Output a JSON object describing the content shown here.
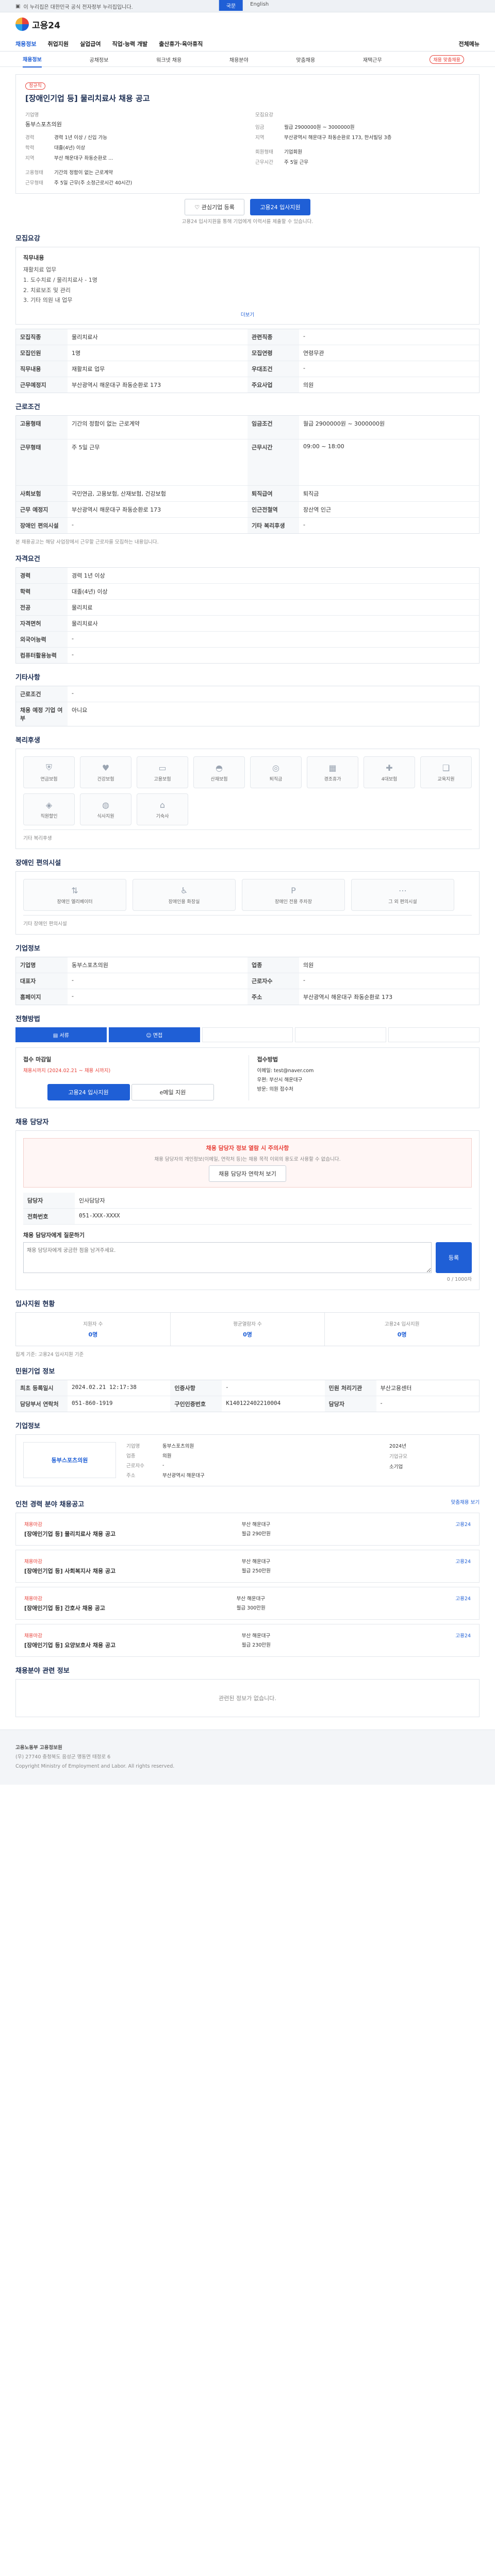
{
  "topbar": {
    "notice": "이 누리집은 대한민국 공식 전자정부 누리집입니다.",
    "lang_ko": "국문",
    "lang_en": "English"
  },
  "header": {
    "logo": "고용24",
    "menu": [
      "채용정보",
      "취업지원",
      "실업급여",
      "직업·능력 개발",
      "출산휴가·육아휴직"
    ],
    "right_menu": "전체메뉴"
  },
  "subtabs": {
    "items": [
      "채용정보",
      "공채정보",
      "워크넷 채용",
      "채용분야",
      "맞춤채용",
      "재택근무"
    ],
    "badge": "채용 맞춤채용"
  },
  "job": {
    "company_badge": "정규직",
    "title": "[장애인기업 등] 물리치료사 채용 공고",
    "company": "동부스포츠의원",
    "fields": [
      {
        "k": "경력",
        "v": "경력 1년 이상 / 신입 가능"
      },
      {
        "k": "학력",
        "v": "대졸(4년) 이상"
      },
      {
        "k": "지역",
        "v": "부산 해운대구 좌동순환로 ..."
      },
      {
        "k": "급여",
        "v": "월급 2,900,000원"
      },
      {
        "k": "고용형태",
        "v": "기간의 정함이 없는 근로계약"
      },
      {
        "k": "근무형태",
        "v": "주 5일 근무(주 소정근로시간 40시간)"
      }
    ],
    "right_fields": [
      {
        "k": "모집요강",
        "v": ""
      },
      {
        "k": "임금",
        "v": "월급 2900000원 ~ 3000000원"
      },
      {
        "k": "지역",
        "v": "부산광역시 해운대구 좌동순환로 173, 한서빌딩 3층"
      },
      {
        "k": "회원형태",
        "v": "기업회원"
      },
      {
        "k": "근무시간",
        "v": "주 5일 근무"
      }
    ]
  },
  "actions": {
    "share": "관심기업 등록",
    "apply": "고용24 입사지원",
    "note": "고용24 입사지원을 통해 기업에게 이력서를 제출할 수 있습니다."
  },
  "detail": {
    "title": "모집요강",
    "duty_label": "직무내용",
    "duty": "재활치료 업무\n1. 도수치료 / 물리치료사 - 1명\n2. 치료보조 및 관리\n3. 기타 의원 내 업무",
    "more": "더보기"
  },
  "recruit": {
    "rows": [
      {
        "k": "모집직종",
        "v": "물리치료사",
        "k2": "관련직종",
        "v2": "-"
      },
      {
        "k": "모집인원",
        "v": "1명",
        "k2": "모집연령",
        "v2": "연령무관"
      },
      {
        "k": "직무내용",
        "v": "재활치료 업무",
        "k2": "우대조건",
        "v2": "-"
      },
      {
        "k": "근무예정지",
        "v": "부산광역시 해운대구 좌동순환로 173",
        "k2": "주요사업",
        "v2": "의원"
      }
    ]
  },
  "conditions": {
    "title": "근로조건",
    "rows": [
      {
        "k": "고용형태",
        "v": "기간의 정함이 없는 근로계약",
        "k2": "임금조건",
        "v2": "월급 2900000원 ~ 3000000원"
      },
      {
        "k": "근무형태",
        "v": "주 5일 근무",
        "k2": "근무시간",
        "v2": "09:00 ~ 18:00"
      },
      {
        "k": "사회보험",
        "v": "국민연금, 고용보험, 산재보험, 건강보험",
        "k2": "퇴직급여",
        "v2": "퇴직금"
      },
      {
        "k": "근무 예정지",
        "v": "부산광역시 해운대구 좌동순환로 173",
        "k2": "인근전철역",
        "v2": "장산역 인근"
      },
      {
        "k": "장애인 편의시설",
        "v": "-",
        "k2": "기타 복리후생",
        "v2": "-"
      }
    ],
    "note": "본 채용공고는 해당 사업장에서 근무할 근로자를 모집하는 내용입니다."
  },
  "qualify": {
    "title": "자격요건",
    "rows": [
      {
        "k": "경력",
        "v": "경력 1년 이상"
      },
      {
        "k": "학력",
        "v": "대졸(4년) 이상"
      },
      {
        "k": "전공",
        "v": "물리치료"
      },
      {
        "k": "자격면허",
        "v": "물리치료사"
      },
      {
        "k": "외국어능력",
        "v": "-"
      },
      {
        "k": "컴퓨터활용능력",
        "v": "-"
      }
    ]
  },
  "other": {
    "title": "기타사항",
    "rows": [
      {
        "k": "근로조건",
        "v": "-"
      },
      {
        "k": "채용 예정 기업 여부",
        "v": "아니요"
      }
    ]
  },
  "welfare": {
    "title": "복리후생",
    "items": [
      "연금보험",
      "건강보험",
      "고용보험",
      "산재보험",
      "퇴직금",
      "경조휴가",
      "4대보험",
      "교육지원",
      "직원할인",
      "식사지원",
      "기숙사"
    ],
    "note": "기타 복리후생"
  },
  "disability": {
    "title": "장애인 편의시설",
    "items": [
      "장애인 엘리베이터",
      "장애인용 화장실",
      "장애인 전용 주차장",
      "그 외 편의시설"
    ],
    "note": "기타 장애인 편의시설"
  },
  "company": {
    "title": "기업정보",
    "rows": [
      {
        "k": "기업명",
        "v": "동부스포츠의원",
        "k2": "업종",
        "v2": "의원"
      },
      {
        "k": "대표자",
        "v": "-",
        "k2": "근로자수",
        "v2": "-"
      },
      {
        "k": "홈페이지",
        "v": "-",
        "k2": "주소",
        "v2": "부산광역시 해운대구 좌동순환로 173"
      }
    ]
  },
  "process": {
    "title": "전형방법",
    "steps": [
      "서류",
      "면접",
      "",
      "",
      ""
    ],
    "apply_title": "접수 마감일",
    "apply_date": "채용시까지 (2024.02.21 ~ 채용 시까지)",
    "apply_method": "고용24 입사지원",
    "method_title": "접수방법",
    "methods": [
      "이메일: test@naver.com",
      "우편: 부산시 해운대구",
      "방문: 의원 접수처"
    ],
    "btn_apply": "고용24 입사지원",
    "btn_email": "e메일 지원"
  },
  "contact": {
    "title": "채용 담당자",
    "alert": "채용 담당자 정보 열람 시 주의사항",
    "alert_text": "채용 담당자의 개인정보(이메일, 연락처 등)는 채용 목적 이외의 용도로 사용할 수 없습니다.",
    "alert_btn": "채용 담당자 연락처 보기",
    "name_label": "담당자",
    "name": "인사담당자",
    "phone_label": "전화번호",
    "phone": "051-XXX-XXXX",
    "desc_label": "채용 담당자에게 질문하기",
    "placeholder": "채용 담당자에게 궁금한 점을 남겨주세요.",
    "send": "등록",
    "count": "0 / 1000자"
  },
  "stats": {
    "title": "입사지원 현황",
    "items": [
      {
        "label": "지원자 수",
        "value": "0명"
      },
      {
        "label": "평균열람자 수",
        "value": "0명"
      },
      {
        "label": "고용24 입사지원",
        "value": "0명"
      }
    ],
    "note": "집계 기준: 고용24 입사지원 기준"
  },
  "info": {
    "title": "민원기업 정보",
    "rows": [
      {
        "k": "최초 등록일시",
        "v": "2024.02.21 12:17:38",
        "k2": "인증사항",
        "v2": "-",
        "k3": "민원 처리기관",
        "v3": "부산고용센터"
      },
      {
        "k": "담당부서 연락처",
        "v": "051-860-1919",
        "k2": "구인인증번호",
        "v2": "K140122402210004",
        "k3": "담당자",
        "v3": "-"
      }
    ]
  },
  "org": {
    "title": "기업정보",
    "name": "동부스포츠의원",
    "labels": [
      "기업명",
      "업종",
      "근로자수",
      "주소"
    ],
    "values": [
      "동부스포츠의원",
      "의원",
      "-",
      "부산광역시 해운대구"
    ],
    "right": [
      "2024년",
      "기업규모",
      "소기업"
    ]
  },
  "similar": {
    "title": "인천 경력 분야 채용공고",
    "more": "맞춤채용 보기",
    "items": [
      {
        "tag": "채용마감",
        "title": "[장애인기업 등] 물리치료사 채용 공고",
        "loc": "부산 해운대구",
        "pay": "월급 290만원",
        "badge": "고용24"
      },
      {
        "tag": "채용마감",
        "title": "[장애인기업 등] 사회복지사 채용 공고",
        "loc": "부산 해운대구",
        "pay": "월급 250만원",
        "badge": "고용24"
      },
      {
        "tag": "채용마감",
        "title": "[장애인기업 등] 간호사 채용 공고",
        "loc": "부산 해운대구",
        "pay": "월급 300만원",
        "badge": "고용24"
      },
      {
        "tag": "채용마감",
        "title": "[장애인기업 등] 요양보호사 채용 공고",
        "loc": "부산 해운대구",
        "pay": "월급 230만원",
        "badge": "고용24"
      }
    ]
  },
  "news": {
    "title": "채용분야 관련 정보",
    "empty": "관련된 정보가 없습니다."
  },
  "footer": {
    "org": "고용노동부 고용정보원",
    "addr": "(우) 27740 충청북도 음성군 맹동면 태정로 6",
    "copy": "Copyright Ministry of Employment and Labor. All rights reserved."
  }
}
